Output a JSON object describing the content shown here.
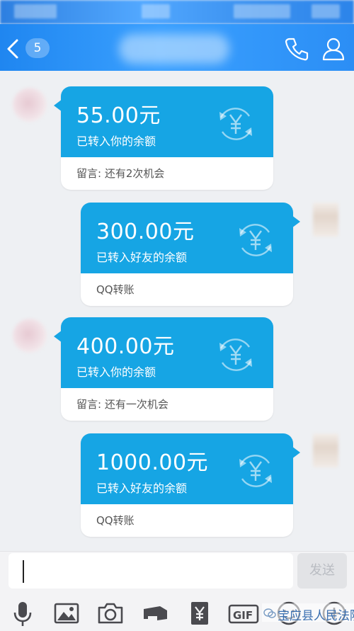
{
  "header": {
    "unread_count": "5"
  },
  "messages": [
    {
      "side": "left",
      "amount": "55.00元",
      "description": "已转入你的余额",
      "note": "留言: 还有2次机会"
    },
    {
      "side": "right",
      "amount": "300.00元",
      "description": "已转入好友的余额",
      "note": "QQ转账"
    },
    {
      "side": "left",
      "amount": "400.00元",
      "description": "已转入你的余额",
      "note": "留言: 还有一次机会"
    },
    {
      "side": "right",
      "amount": "1000.00元",
      "description": "已转入好友的余额",
      "note": "QQ转账"
    }
  ],
  "input": {
    "send_label": "发送"
  },
  "toolbar": {
    "items": [
      "microphone-icon",
      "image-icon",
      "camera-icon",
      "red-packet-icon",
      "transfer-icon",
      "gif-icon",
      "emoji-icon",
      "more-icon"
    ]
  },
  "watermark": {
    "text": "宝应县人民法院"
  },
  "colors": {
    "header_blue": "#2b8ef5",
    "transfer_blue": "#16a5e4",
    "background": "#eef0f3"
  }
}
